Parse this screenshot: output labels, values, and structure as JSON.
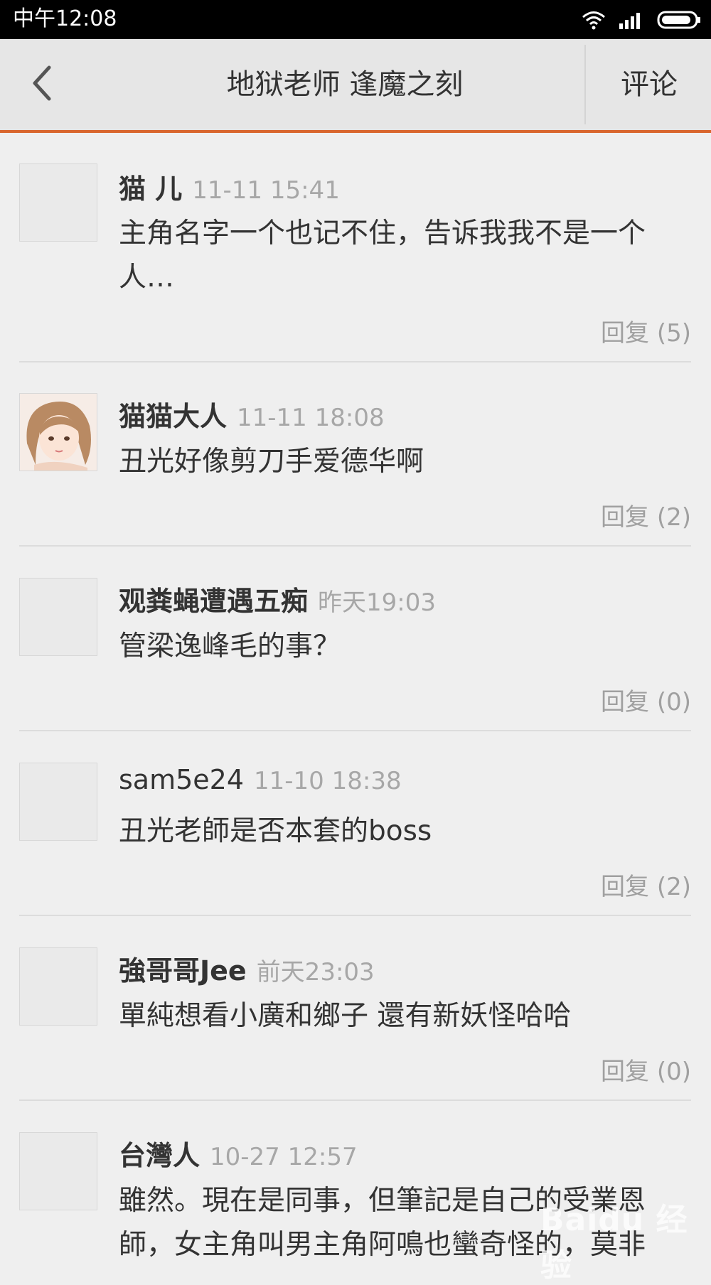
{
  "status_bar": {
    "time": "中午12:08"
  },
  "header": {
    "title": "地狱老师 逢魔之刻",
    "comment_label": "评论"
  },
  "comments": [
    {
      "name": "猫 儿",
      "time": "11-11 15:41",
      "text": "主角名字一个也记不住，告诉我我不是一个人…",
      "reply": "回复 (5)"
    },
    {
      "name": "猫猫大人",
      "time": "11-11 18:08",
      "text": "丑光好像剪刀手爱德华啊",
      "reply": "回复 (2)"
    },
    {
      "name": "观粪蝇遭遇五痴",
      "time": "昨天19:03",
      "text": "管梁逸峰毛的事？",
      "reply": "回复 (0)"
    },
    {
      "name": "sam5e24",
      "time": "11-10 18:38",
      "text": "丑光老師是否本套的boss",
      "reply": "回复 (2)"
    },
    {
      "name": "強哥哥Jee",
      "time": "前天23:03",
      "text": "單純想看小廣和鄉子 還有新妖怪哈哈",
      "reply": "回复 (0)"
    },
    {
      "name": "台灣人",
      "time": "10-27 12:57",
      "text": "雖然。現在是同事，但筆記是自己的受業恩師，女主角叫男主角阿鳴也蠻奇怪的，莫非"
    }
  ],
  "watermark": "Baidu 经验"
}
